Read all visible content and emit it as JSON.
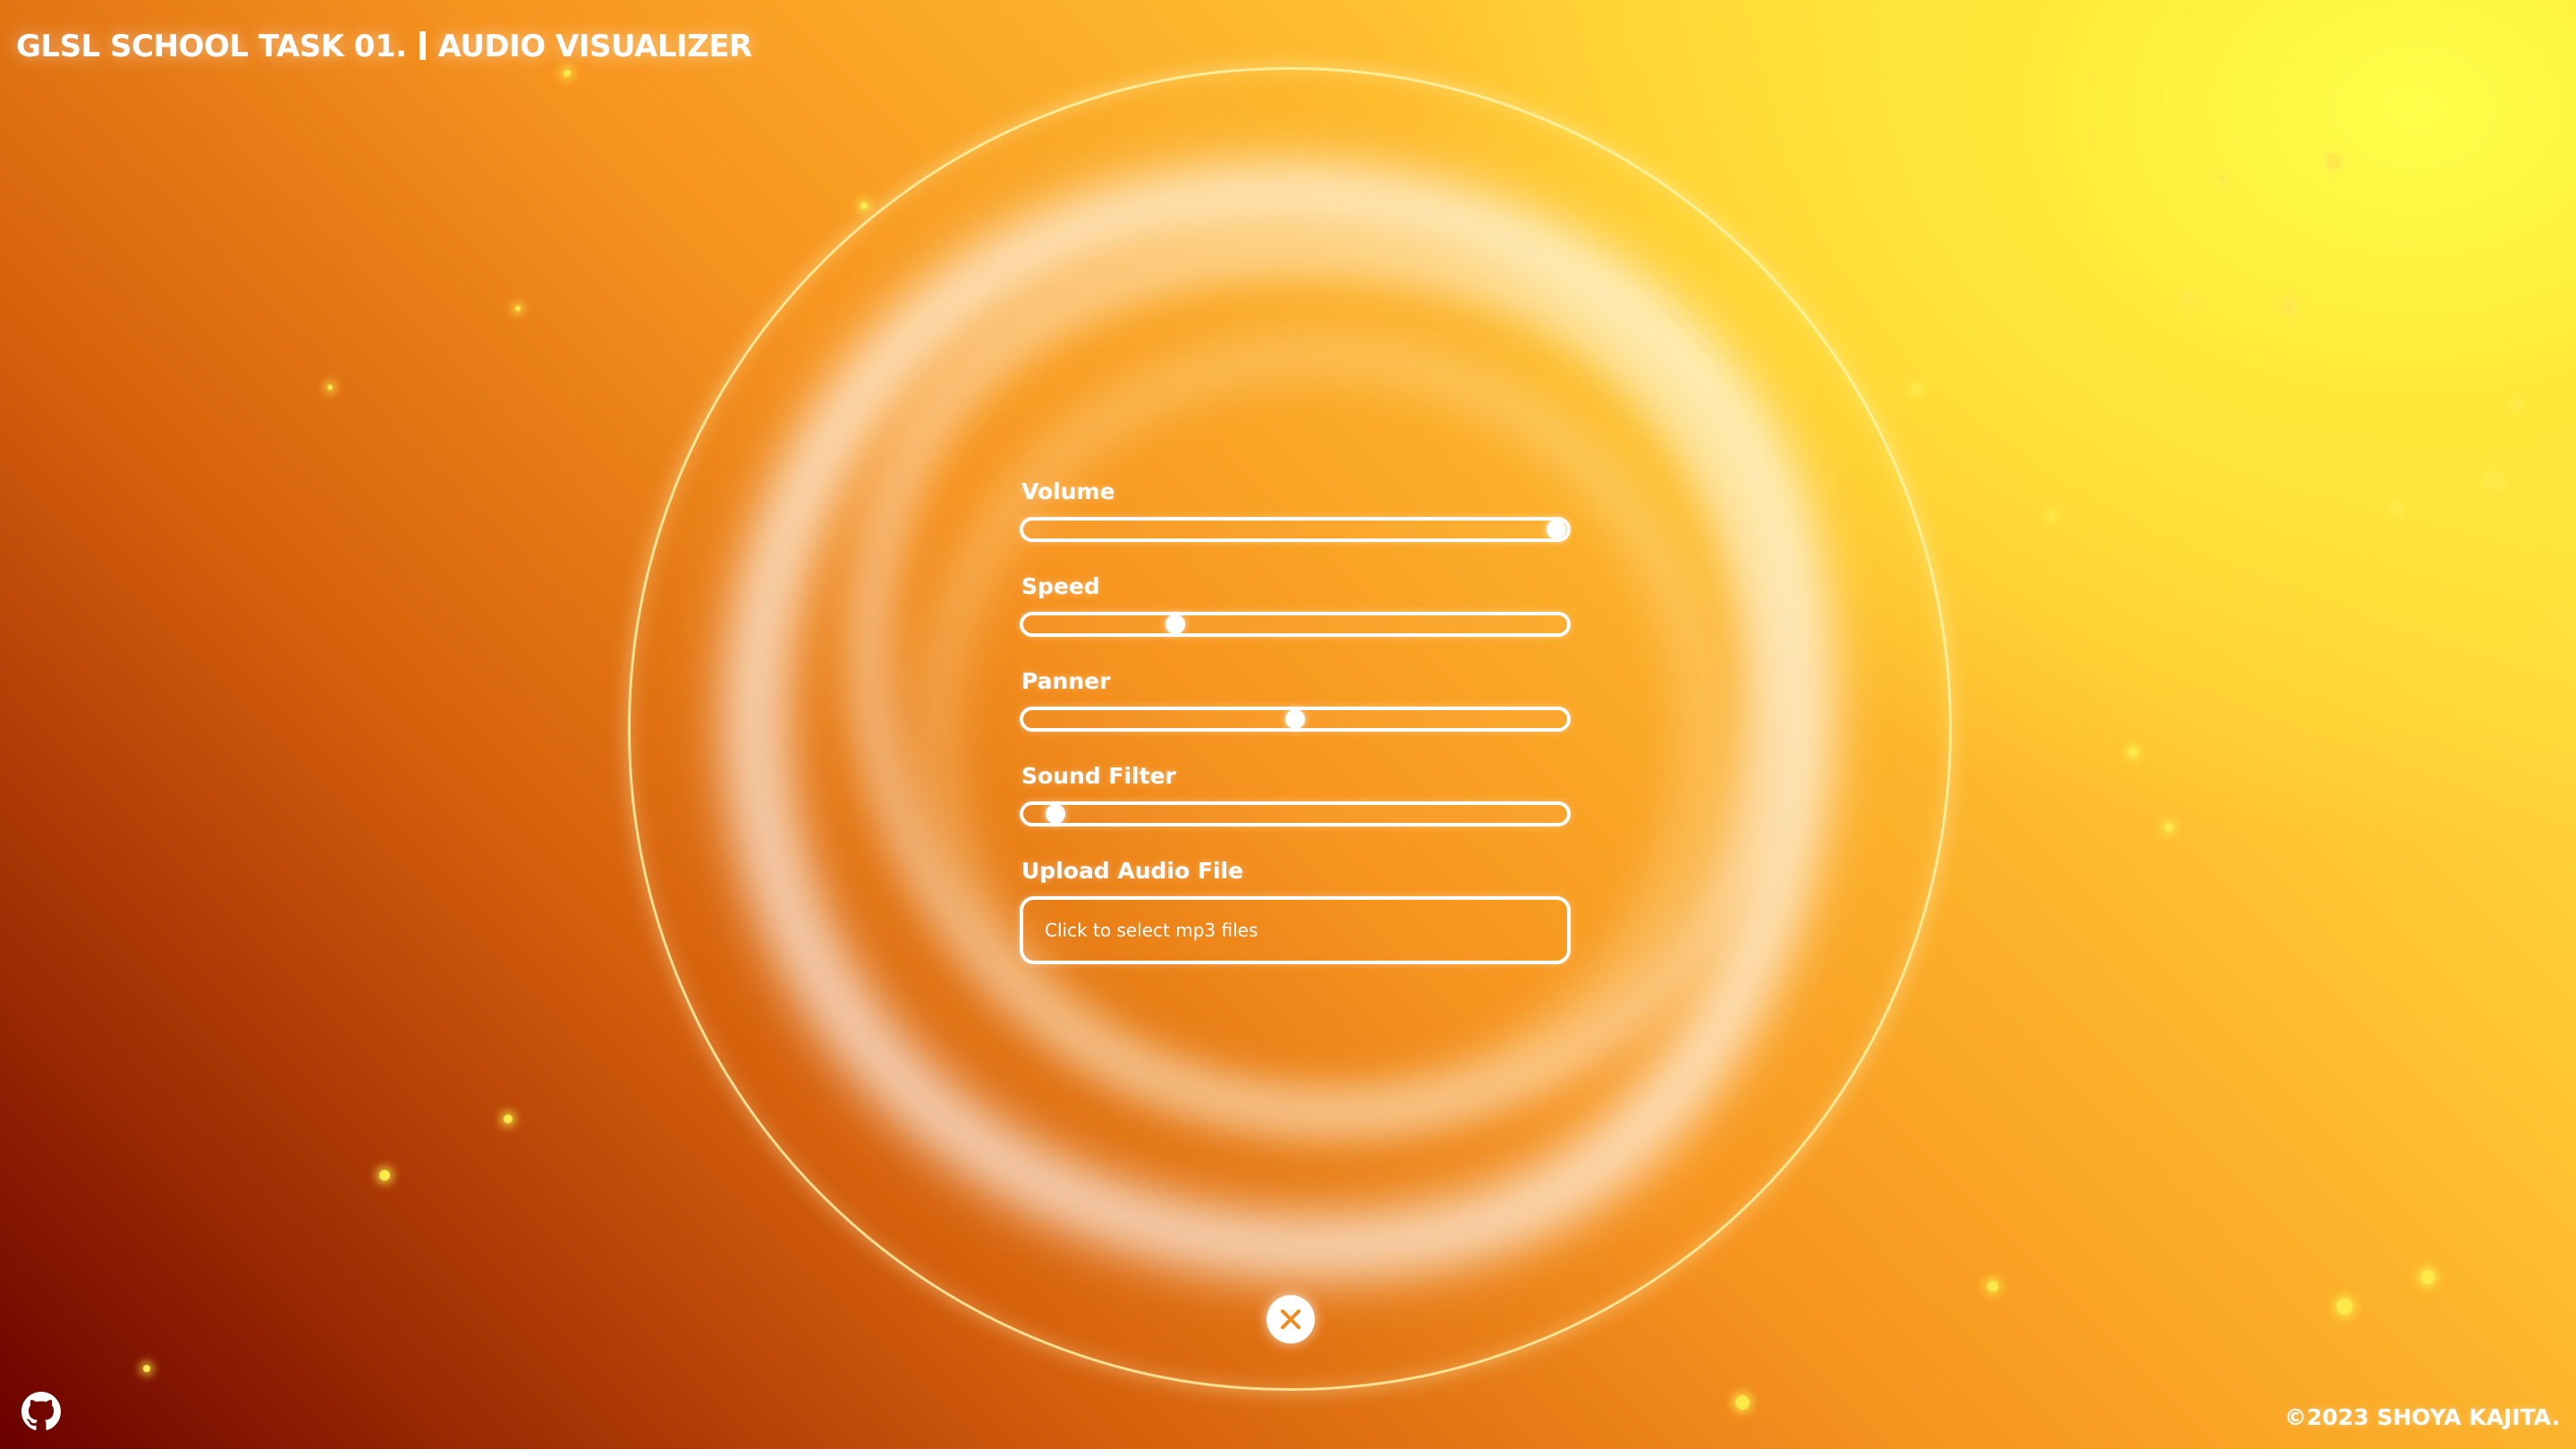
{
  "header": {
    "title_left": "GLSL SCHOOL TASK 01.",
    "title_right": "AUDIO VISUALIZER"
  },
  "controls": {
    "sliders": [
      {
        "label": "Volume",
        "value_fraction": 0.98
      },
      {
        "label": "Speed",
        "value_fraction": 0.28
      },
      {
        "label": "Panner",
        "value_fraction": 0.5
      },
      {
        "label": "Sound Filter",
        "value_fraction": 0.06
      }
    ],
    "upload": {
      "label": "Upload Audio File",
      "placeholder": "Click to select mp3 files"
    }
  },
  "icons": {
    "close": "close-icon",
    "github": "github-icon"
  },
  "footer": {
    "copyright": "©2023 SHOYA KAJITA."
  },
  "colors": {
    "accent": "#ffffff",
    "background_warm": "#f7941f",
    "background_light": "#fff44a",
    "background_dark": "#6a0000"
  }
}
